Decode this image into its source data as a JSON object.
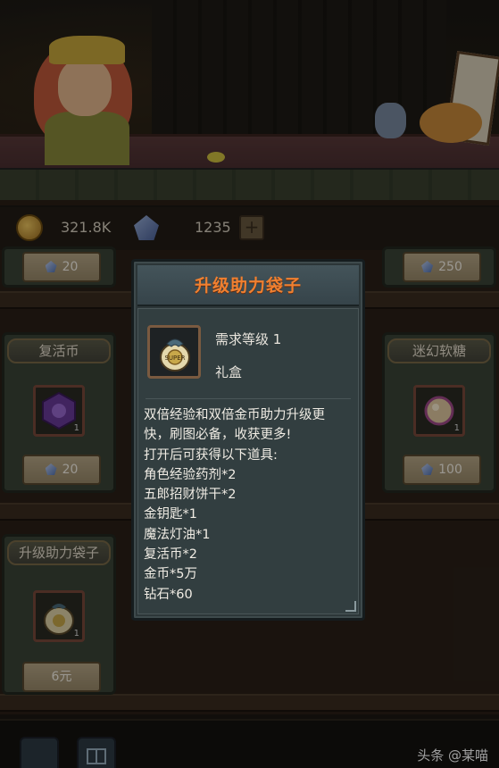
{
  "currency": {
    "gold": "321.8K",
    "gems": "1235"
  },
  "shop": {
    "cards": [
      {
        "title": "",
        "price": "20"
      },
      {
        "title": "",
        "price": "250"
      },
      {
        "title": "复活币",
        "qty": "1",
        "price": "20"
      },
      {
        "title": "迷幻软糖",
        "qty": "1",
        "price": "100"
      },
      {
        "title": "升级助力袋子",
        "qty": "1",
        "price": "6元"
      }
    ]
  },
  "popup": {
    "title": "升级助力袋子",
    "required_level": "需求等级 1",
    "item_type": "礼盒",
    "description_lines": [
      "双倍经验和双倍金币助力升级更",
      "快，刷图必备，收获更多!",
      "打开后可获得以下道具:",
      "角色经验药剂*2",
      "五郎招财饼干*2",
      "金钥匙*1",
      "魔法灯油*1",
      "复活币*2",
      "金币*5万",
      "钻石*60"
    ]
  },
  "watermark": "头条 @某喵",
  "colors": {
    "popup_title": "#f08030",
    "popup_bg": "#2c3638",
    "card_bg": "#3a4438"
  },
  "icons": {
    "gold": "gold-coin-icon",
    "gems": "gem-icon",
    "item": "gift-bag-icon"
  }
}
